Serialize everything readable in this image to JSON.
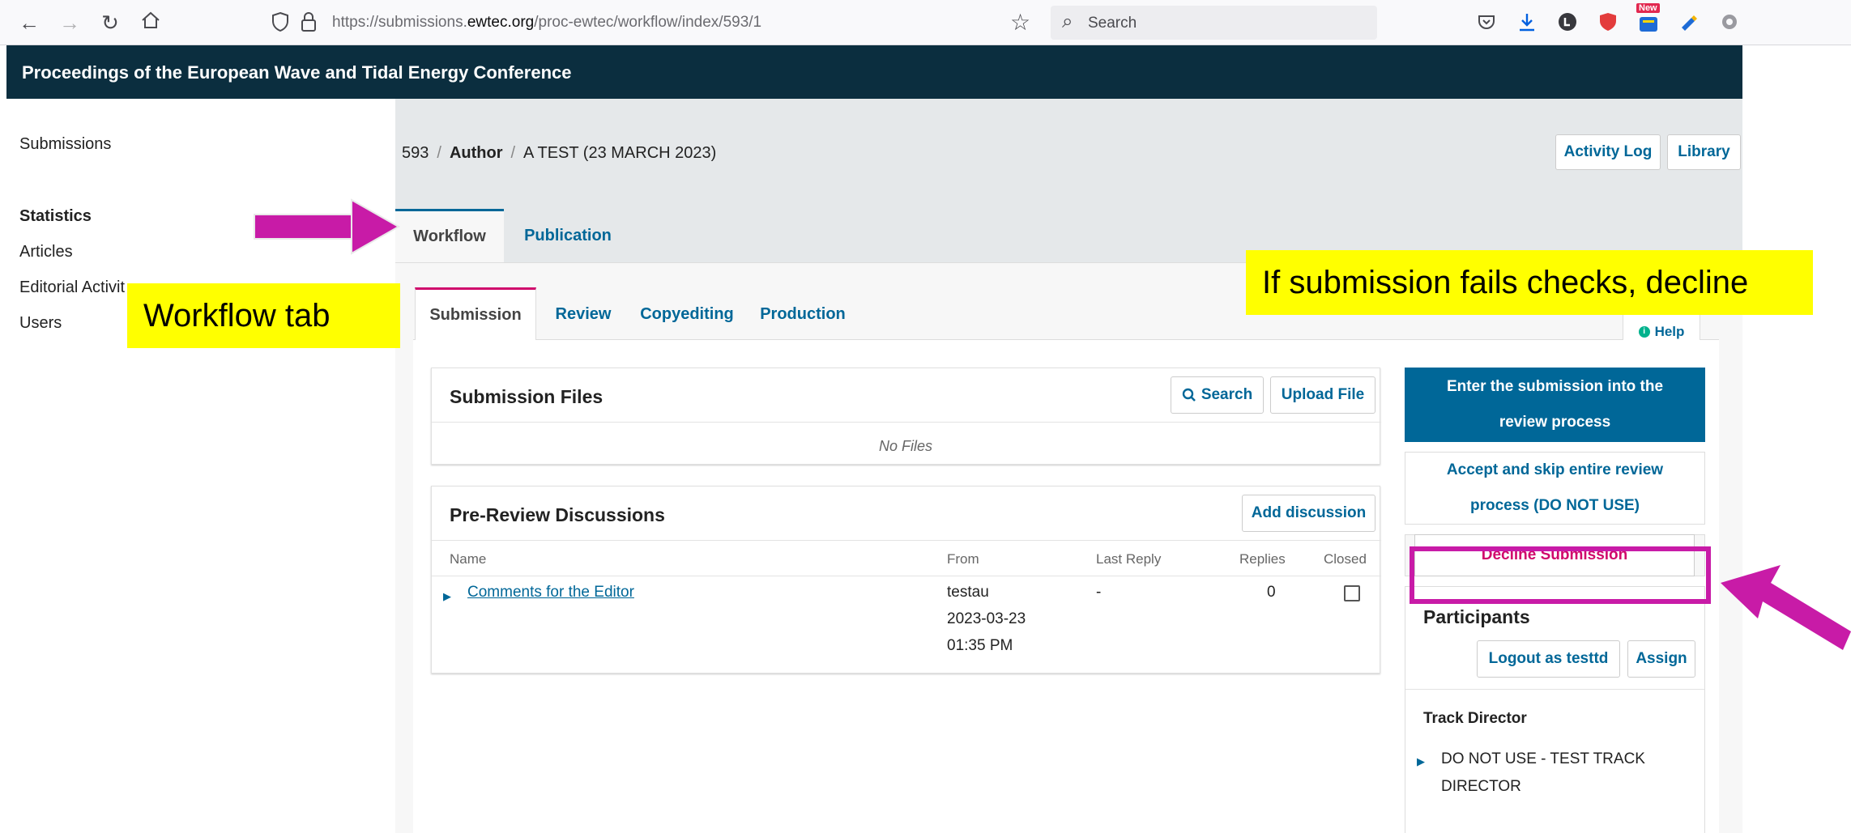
{
  "browser": {
    "url_prefix": "https://submissions.",
    "url_domain": "ewtec.org",
    "url_path": "/proc-ewtec/workflow/index/593/1",
    "search_placeholder": "Search",
    "ext_badge": "New"
  },
  "site": {
    "title": "Proceedings of the European Wave and Tidal Energy Conference"
  },
  "sidebar": {
    "items": [
      {
        "label": "Submissions"
      },
      {
        "label": "Statistics"
      },
      {
        "label": "Articles"
      },
      {
        "label": "Editorial Activit"
      },
      {
        "label": "Users"
      }
    ]
  },
  "breadcrumb": {
    "id": "593",
    "sep": "/",
    "role": "Author",
    "title": "A TEST (23 MARCH 2023)"
  },
  "header_buttons": {
    "activity_log": "Activity Log",
    "library": "Library"
  },
  "top_tabs": {
    "workflow": "Workflow",
    "publication": "Publication"
  },
  "stage_tabs": {
    "submission": "Submission",
    "review": "Review",
    "copyediting": "Copyediting",
    "production": "Production",
    "help": "Help",
    "help_icon": "i"
  },
  "submission_files": {
    "title": "Submission Files",
    "search": "Search",
    "upload": "Upload File",
    "empty": "No Files"
  },
  "discussions": {
    "title": "Pre-Review Discussions",
    "add": "Add discussion",
    "columns": {
      "name": "Name",
      "from": "From",
      "last_reply": "Last Reply",
      "replies": "Replies",
      "closed": "Closed"
    },
    "rows": [
      {
        "name": "Comments for the Editor",
        "from_user": "testau",
        "from_date": "2023-03-23",
        "from_time": "01:35 PM",
        "last_reply": "-",
        "replies": "0",
        "closed": false
      }
    ]
  },
  "actions": {
    "send_to_review": "Enter the submission into the review process",
    "accept_skip": "Accept and skip entire review process (DO NOT USE)",
    "decline": "Decline Submission"
  },
  "participants": {
    "title": "Participants",
    "logout_as": "Logout as testtd",
    "assign": "Assign",
    "role": "Track Director",
    "person": "DO NOT USE - TEST TRACK DIRECTOR"
  },
  "annotations": {
    "workflow_tab": "Workflow tab",
    "decline_note": "If submission fails checks, decline"
  },
  "colors": {
    "header_bg": "#0b2e3f",
    "link": "#006798",
    "decline": "#d00a6c",
    "arrow": "#c81ba7",
    "callout": "#ffff00"
  }
}
